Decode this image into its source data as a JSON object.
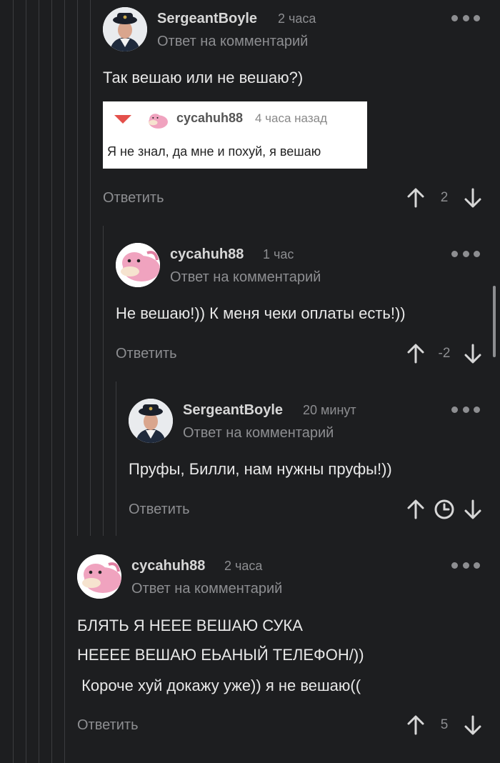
{
  "comments": [
    {
      "author": "SergeantBoyle",
      "time": "2 часа",
      "reply_to": "Ответ на комментарий",
      "lines": [
        "Так вешаю или не вешаю?)"
      ],
      "reply": "Ответить",
      "rating": "2"
    },
    {
      "author": "cycahuh88",
      "time": "1 час",
      "reply_to": "Ответ на комментарий",
      "lines": [
        "Не вешаю!)) К меня чеки оплаты есть!))"
      ],
      "reply": "Ответить",
      "rating": "-2"
    },
    {
      "author": "SergeantBoyle",
      "time": "20 минут",
      "reply_to": "Ответ на комментарий",
      "lines": [
        "Пруфы, Билли, нам нужны пруфы!))"
      ],
      "reply": "Ответить",
      "rating": ""
    },
    {
      "author": "cycahuh88",
      "time": "2 часа",
      "reply_to": "Ответ на комментарий",
      "lines": [
        "БЛЯТЬ Я НЕЕЕ ВЕШАЮ СУКА",
        "НЕЕЕЕ ВЕШАЮ ЕЬАНЫЙ ТЕЛЕФОН/))",
        " Короче хуй докажу уже)) я не вешаю(("
      ],
      "reply": "Ответить",
      "rating": "5"
    }
  ],
  "quote": {
    "author": "cycahuh88",
    "time": "4 часа назад",
    "text": "Я не знал, да мне и похуй, я вешаю"
  },
  "colors": {
    "background": "#1d1e20",
    "quote_arrow": "#e4504b",
    "avatar_pink": "#f0a3bf"
  },
  "icons": [
    "user-avatar-officer",
    "user-avatar-slowpoke",
    "more-dots-icon",
    "arrow-up-icon",
    "arrow-down-icon",
    "clock-icon",
    "triangle-down-icon"
  ]
}
